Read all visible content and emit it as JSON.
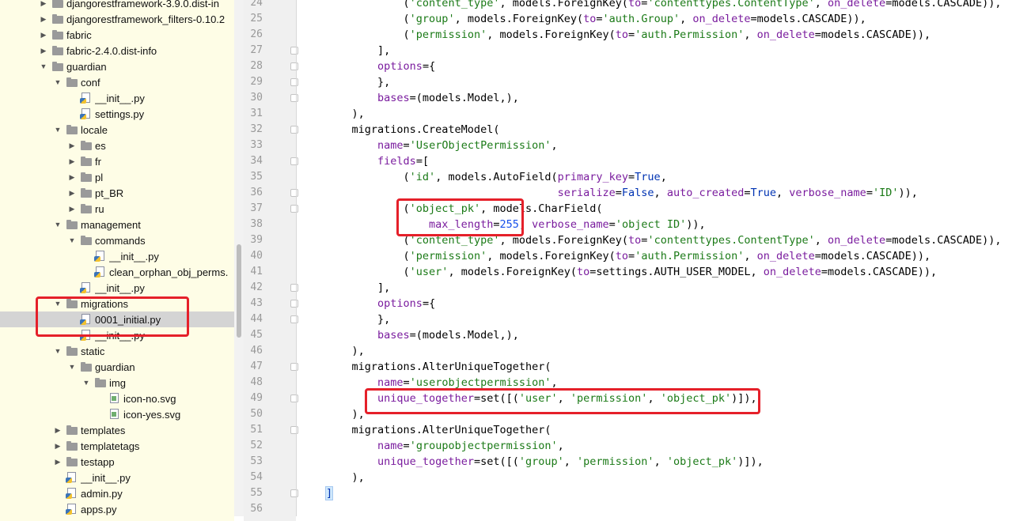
{
  "project_tree": {
    "items": [
      {
        "label": "djangorestframework-3.9.0.dist-in",
        "kind": "folder",
        "expanded": false
      },
      {
        "label": "djangorestframework_filters-0.10.2",
        "kind": "folder",
        "expanded": false
      },
      {
        "label": "fabric",
        "kind": "folder",
        "expanded": false
      },
      {
        "label": "fabric-2.4.0.dist-info",
        "kind": "folder",
        "expanded": false
      },
      {
        "label": "guardian",
        "kind": "folder",
        "expanded": true
      },
      {
        "label": "conf",
        "kind": "folder",
        "expanded": true
      },
      {
        "label": "__init__.py",
        "kind": "python-file"
      },
      {
        "label": "settings.py",
        "kind": "python-file"
      },
      {
        "label": "locale",
        "kind": "folder",
        "expanded": true
      },
      {
        "label": "es",
        "kind": "folder",
        "expanded": false
      },
      {
        "label": "fr",
        "kind": "folder",
        "expanded": false
      },
      {
        "label": "pl",
        "kind": "folder",
        "expanded": false
      },
      {
        "label": "pt_BR",
        "kind": "folder",
        "expanded": false
      },
      {
        "label": "ru",
        "kind": "folder",
        "expanded": false
      },
      {
        "label": "management",
        "kind": "folder",
        "expanded": true
      },
      {
        "label": "commands",
        "kind": "folder",
        "expanded": true
      },
      {
        "label": "__init__.py",
        "kind": "python-file"
      },
      {
        "label": "clean_orphan_obj_perms.",
        "kind": "python-file"
      },
      {
        "label": "__init__.py",
        "kind": "python-file"
      },
      {
        "label": "migrations",
        "kind": "folder",
        "expanded": true
      },
      {
        "label": "0001_initial.py",
        "kind": "python-file",
        "selected": true
      },
      {
        "label": "__init__.py",
        "kind": "python-file"
      },
      {
        "label": "static",
        "kind": "folder",
        "expanded": true
      },
      {
        "label": "guardian",
        "kind": "folder",
        "expanded": true
      },
      {
        "label": "img",
        "kind": "folder",
        "expanded": true
      },
      {
        "label": "icon-no.svg",
        "kind": "svg-file"
      },
      {
        "label": "icon-yes.svg",
        "kind": "svg-file"
      },
      {
        "label": "templates",
        "kind": "folder",
        "expanded": false
      },
      {
        "label": "templatetags",
        "kind": "folder",
        "expanded": false
      },
      {
        "label": "testapp",
        "kind": "folder",
        "expanded": false
      },
      {
        "label": "__init__.py",
        "kind": "python-file"
      },
      {
        "label": "admin.py",
        "kind": "python-file"
      },
      {
        "label": "apps.py",
        "kind": "python-file"
      }
    ]
  },
  "editor": {
    "first_line_number": 24,
    "lines": [
      [
        [
          "            (",
          ""
        ],
        [
          "'content_type'",
          "s"
        ],
        [
          ", models.ForeignKey(",
          ""
        ],
        [
          "to",
          "k"
        ],
        [
          "=",
          ""
        ],
        [
          "'contenttypes.ContentType'",
          "s"
        ],
        [
          ", ",
          ""
        ],
        [
          "on_delete",
          "k"
        ],
        [
          "=models.CASCADE)),",
          ""
        ]
      ],
      [
        [
          "            (",
          ""
        ],
        [
          "'group'",
          "s"
        ],
        [
          ", models.ForeignKey(",
          ""
        ],
        [
          "to",
          "k"
        ],
        [
          "=",
          ""
        ],
        [
          "'auth.Group'",
          "s"
        ],
        [
          ", ",
          ""
        ],
        [
          "on_delete",
          "k"
        ],
        [
          "=models.CASCADE)),",
          ""
        ]
      ],
      [
        [
          "            (",
          ""
        ],
        [
          "'permission'",
          "s"
        ],
        [
          ", models.ForeignKey(",
          ""
        ],
        [
          "to",
          "k"
        ],
        [
          "=",
          ""
        ],
        [
          "'auth.Permission'",
          "s"
        ],
        [
          ", ",
          ""
        ],
        [
          "on_delete",
          "k"
        ],
        [
          "=models.CASCADE)),",
          ""
        ]
      ],
      [
        [
          "        ],",
          ""
        ]
      ],
      [
        [
          "        ",
          ""
        ],
        [
          "options",
          "k"
        ],
        [
          "={",
          ""
        ]
      ],
      [
        [
          "        },",
          ""
        ]
      ],
      [
        [
          "        ",
          ""
        ],
        [
          "bases",
          "k"
        ],
        [
          "=(models.Model,),",
          ""
        ]
      ],
      [
        [
          "    ),",
          ""
        ]
      ],
      [
        [
          "    migrations.CreateModel(",
          ""
        ]
      ],
      [
        [
          "        ",
          ""
        ],
        [
          "name",
          "k"
        ],
        [
          "=",
          ""
        ],
        [
          "'UserObjectPermission'",
          "s"
        ],
        [
          ",",
          ""
        ]
      ],
      [
        [
          "        ",
          ""
        ],
        [
          "fields",
          "k"
        ],
        [
          "=[",
          ""
        ]
      ],
      [
        [
          "            (",
          ""
        ],
        [
          "'id'",
          "s"
        ],
        [
          ", models.AutoField(",
          ""
        ],
        [
          "primary_key",
          "k"
        ],
        [
          "=",
          ""
        ],
        [
          "True",
          "kw"
        ],
        [
          ",",
          ""
        ]
      ],
      [
        [
          "                                    ",
          ""
        ],
        [
          "serialize",
          "k"
        ],
        [
          "=",
          ""
        ],
        [
          "False",
          "kw"
        ],
        [
          ", ",
          ""
        ],
        [
          "auto_created",
          "k"
        ],
        [
          "=",
          ""
        ],
        [
          "True",
          "kw"
        ],
        [
          ", ",
          ""
        ],
        [
          "verbose_name",
          "k"
        ],
        [
          "=",
          ""
        ],
        [
          "'ID'",
          "s"
        ],
        [
          ")),",
          ""
        ]
      ],
      [
        [
          "            (",
          ""
        ],
        [
          "'object_pk'",
          "s"
        ],
        [
          ", models.CharField(",
          ""
        ]
      ],
      [
        [
          "                ",
          ""
        ],
        [
          "max_length",
          "k"
        ],
        [
          "=",
          ""
        ],
        [
          "255",
          "n"
        ],
        [
          ", ",
          ""
        ],
        [
          "verbose_name",
          "k"
        ],
        [
          "=",
          ""
        ],
        [
          "'object ID'",
          "s"
        ],
        [
          ")),",
          ""
        ]
      ],
      [
        [
          "            (",
          ""
        ],
        [
          "'content_type'",
          "s"
        ],
        [
          ", models.ForeignKey(",
          ""
        ],
        [
          "to",
          "k"
        ],
        [
          "=",
          ""
        ],
        [
          "'contenttypes.ContentType'",
          "s"
        ],
        [
          ", ",
          ""
        ],
        [
          "on_delete",
          "k"
        ],
        [
          "=models.CASCADE)),",
          ""
        ]
      ],
      [
        [
          "            (",
          ""
        ],
        [
          "'permission'",
          "s"
        ],
        [
          ", models.ForeignKey(",
          ""
        ],
        [
          "to",
          "k"
        ],
        [
          "=",
          ""
        ],
        [
          "'auth.Permission'",
          "s"
        ],
        [
          ", ",
          ""
        ],
        [
          "on_delete",
          "k"
        ],
        [
          "=models.CASCADE)),",
          ""
        ]
      ],
      [
        [
          "            (",
          ""
        ],
        [
          "'user'",
          "s"
        ],
        [
          ", models.ForeignKey(",
          ""
        ],
        [
          "to",
          "k"
        ],
        [
          "=settings.AUTH_USER_MODEL, ",
          ""
        ],
        [
          "on_delete",
          "k"
        ],
        [
          "=models.CASCADE)),",
          ""
        ]
      ],
      [
        [
          "        ],",
          ""
        ]
      ],
      [
        [
          "        ",
          ""
        ],
        [
          "options",
          "k"
        ],
        [
          "={",
          ""
        ]
      ],
      [
        [
          "        },",
          ""
        ]
      ],
      [
        [
          "        ",
          ""
        ],
        [
          "bases",
          "k"
        ],
        [
          "=(models.Model,),",
          ""
        ]
      ],
      [
        [
          "    ),",
          ""
        ]
      ],
      [
        [
          "    migrations.AlterUniqueTogether(",
          ""
        ]
      ],
      [
        [
          "        ",
          ""
        ],
        [
          "name",
          "k"
        ],
        [
          "=",
          ""
        ],
        [
          "'userobjectpermission'",
          "s"
        ],
        [
          ",",
          ""
        ]
      ],
      [
        [
          "        ",
          ""
        ],
        [
          "unique_together",
          "k"
        ],
        [
          "=set([(",
          ""
        ],
        [
          "'user'",
          "s"
        ],
        [
          ", ",
          ""
        ],
        [
          "'permission'",
          "s"
        ],
        [
          ", ",
          ""
        ],
        [
          "'object_pk'",
          "s"
        ],
        [
          ")]),",
          ""
        ]
      ],
      [
        [
          "    ),",
          ""
        ]
      ],
      [
        [
          "    migrations.AlterUniqueTogether(",
          ""
        ]
      ],
      [
        [
          "        ",
          ""
        ],
        [
          "name",
          "k"
        ],
        [
          "=",
          ""
        ],
        [
          "'groupobjectpermission'",
          "s"
        ],
        [
          ",",
          ""
        ]
      ],
      [
        [
          "        ",
          ""
        ],
        [
          "unique_together",
          "k"
        ],
        [
          "=set([(",
          ""
        ],
        [
          "'group'",
          "s"
        ],
        [
          ", ",
          ""
        ],
        [
          "'permission'",
          "s"
        ],
        [
          ", ",
          ""
        ],
        [
          "'object_pk'",
          "s"
        ],
        [
          ")]),",
          ""
        ]
      ],
      [
        [
          "    ),",
          ""
        ]
      ],
      [
        [
          "]",
          "b"
        ]
      ],
      [
        [
          "",
          ""
        ]
      ]
    ],
    "fold_marker_lines": [
      27,
      28,
      29,
      30,
      32,
      34,
      36,
      37,
      42,
      43,
      44,
      47,
      49,
      51,
      55
    ]
  },
  "annotations": {
    "color": "#e5202a"
  }
}
